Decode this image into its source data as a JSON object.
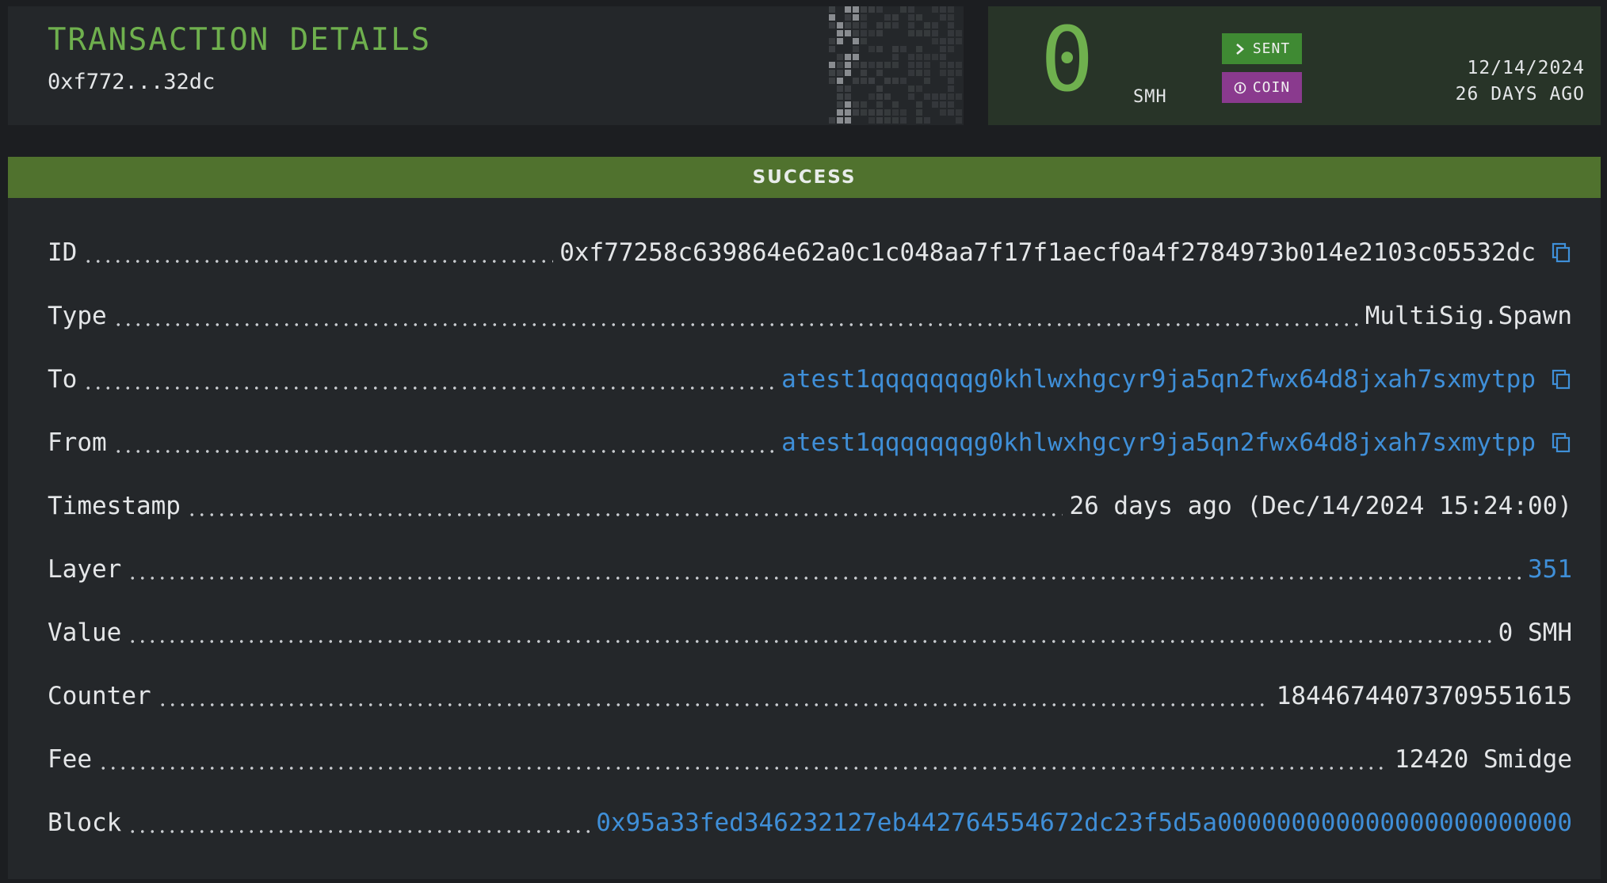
{
  "header": {
    "title": "TRANSACTION DETAILS",
    "short_id": "0xf772...32dc"
  },
  "amount": {
    "value": "0",
    "unit": "SMH",
    "badges": [
      {
        "label": "SENT",
        "icon": "chevron-right-icon",
        "color": "#3f8a33"
      },
      {
        "label": "COIN",
        "icon": "coin-icon",
        "color": "#8a3a8e"
      }
    ],
    "date": "12/14/2024",
    "relative": "26 DAYS AGO"
  },
  "status": {
    "label": "SUCCESS",
    "color": "#50722e"
  },
  "details": [
    {
      "label": "ID",
      "value": "0xf77258c639864e62a0c1c048aa7f17f1aecf0a4f2784973b014e2103c05532dc",
      "link": false,
      "copy": true
    },
    {
      "label": "Type",
      "value": "MultiSig.Spawn",
      "link": false,
      "copy": false
    },
    {
      "label": "To",
      "value": "atest1qqqqqqqg0khlwxhgcyr9ja5qn2fwx64d8jxah7sxmytpp",
      "link": true,
      "copy": true
    },
    {
      "label": "From",
      "value": "atest1qqqqqqqg0khlwxhgcyr9ja5qn2fwx64d8jxah7sxmytpp",
      "link": true,
      "copy": true
    },
    {
      "label": "Timestamp",
      "value": "26 days ago (Dec/14/2024 15:24:00)",
      "link": false,
      "copy": false
    },
    {
      "label": "Layer",
      "value": "351",
      "link": true,
      "copy": false
    },
    {
      "label": "Value",
      "value": "0 SMH",
      "link": false,
      "copy": false
    },
    {
      "label": "Counter",
      "value": "18446744073709551615",
      "link": false,
      "copy": false
    },
    {
      "label": "Fee",
      "value": "12420 Smidge",
      "link": false,
      "copy": false
    },
    {
      "label": "Block",
      "value": "0x95a33fed346232127eb442764554672dc23f5d5a000000000000000000000000",
      "link": true,
      "copy": false
    }
  ],
  "colors": {
    "accent_green": "#6fb04e",
    "link_blue": "#3f8fd8"
  }
}
